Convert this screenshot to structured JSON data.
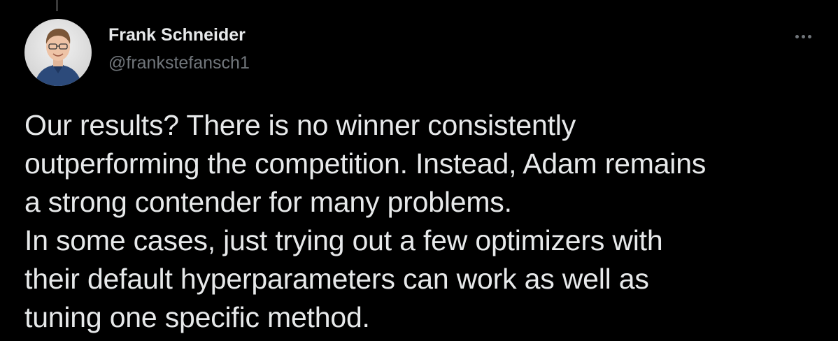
{
  "tweet": {
    "author": {
      "display_name": "Frank Schneider",
      "handle": "@frankstefansch1"
    },
    "more_icon": "ellipsis-icon",
    "text_lines": [
      "Our results? There is no winner consistently",
      "outperforming the competition. Instead, Adam remains",
      "a strong contender for many problems.",
      "In some cases, just trying out a few optimizers with",
      "their default hyperparameters can work as well as",
      "tuning one specific method."
    ]
  },
  "colors": {
    "background": "#000000",
    "primary_text": "#e7e9ea",
    "secondary_text": "#71767b"
  }
}
